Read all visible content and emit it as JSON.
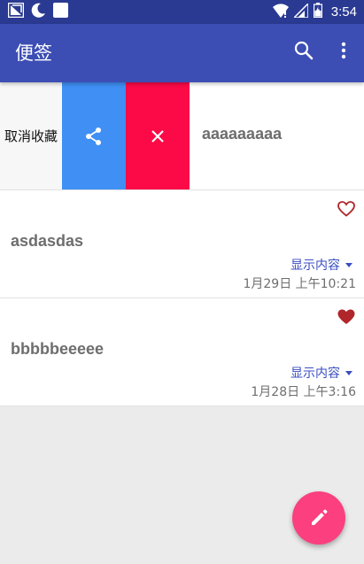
{
  "status_bar": {
    "time": "3:54",
    "left_icons": [
      "app-notification-icon",
      "moon-icon",
      "square-icon"
    ],
    "right_icons": [
      "wifi-icon",
      "signal-icon",
      "battery-icon"
    ]
  },
  "app_bar": {
    "title": "便签",
    "color": "#3c4eb4",
    "actions": [
      "search-icon",
      "more-vert-icon"
    ]
  },
  "swiped_note": {
    "unfavorite_label": "取消收藏",
    "share_icon": "share-icon",
    "delete_icon": "close-icon",
    "title": "aaaaaaaaa",
    "share_color": "#3f8ff4",
    "delete_color": "#fb0a47"
  },
  "notes": [
    {
      "title": "asdasdas",
      "favorited": false,
      "show_content_label": "显示内容",
      "date": "1月29日 上午10:21"
    },
    {
      "title": "bbbbbeeeee",
      "favorited": true,
      "show_content_label": "显示内容",
      "date": "1月28日 上午3:16"
    }
  ],
  "fab": {
    "icon": "pencil-icon",
    "color": "#fb3f7f"
  }
}
